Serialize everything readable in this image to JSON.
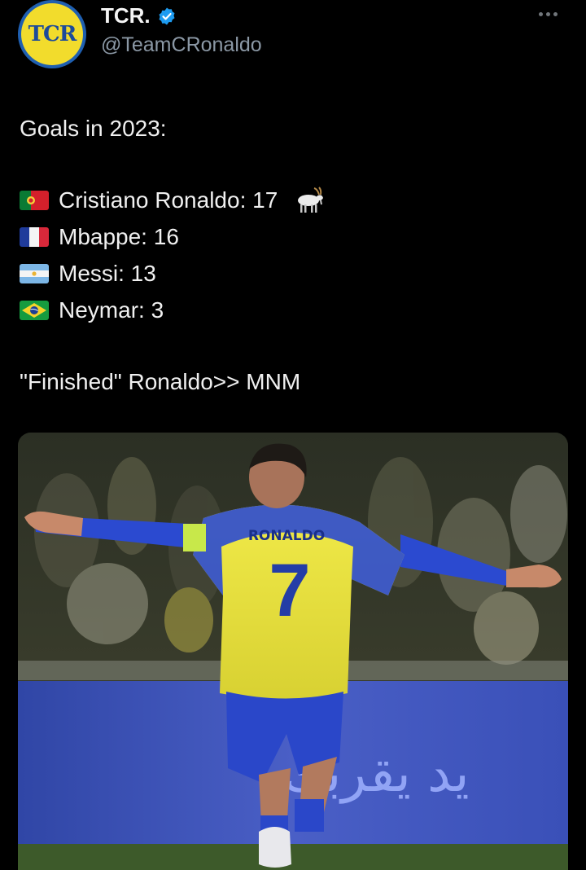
{
  "tweet": {
    "display_name": "TCR.",
    "handle": "@TeamCRonaldo",
    "avatar_text": "TCR",
    "lines": {
      "title": "Goals in 2023:",
      "row1": "Cristiano Ronaldo: 17",
      "row2": "Mbappe: 16",
      "row3": "Messi: 13",
      "row4": "Neymar: 3",
      "closing": "\"Finished\" Ronaldo>> MNM"
    },
    "flags": [
      "portugal-flag-icon",
      "france-flag-icon",
      "argentina-flag-icon",
      "brazil-flag-icon"
    ],
    "extra_icons": [
      "goat-emoji-icon",
      "verified-badge-icon",
      "more-options-icon"
    ]
  },
  "media": {
    "jersey_name": "RONALDO",
    "jersey_number": "7",
    "banner_text": "يد يقربك"
  },
  "colors": {
    "background": "#000000",
    "verified": "#1d9bf0",
    "handle": "#8b98a5",
    "jersey_yellow": "#e8e23a",
    "jersey_blue": "#2a47c9"
  }
}
